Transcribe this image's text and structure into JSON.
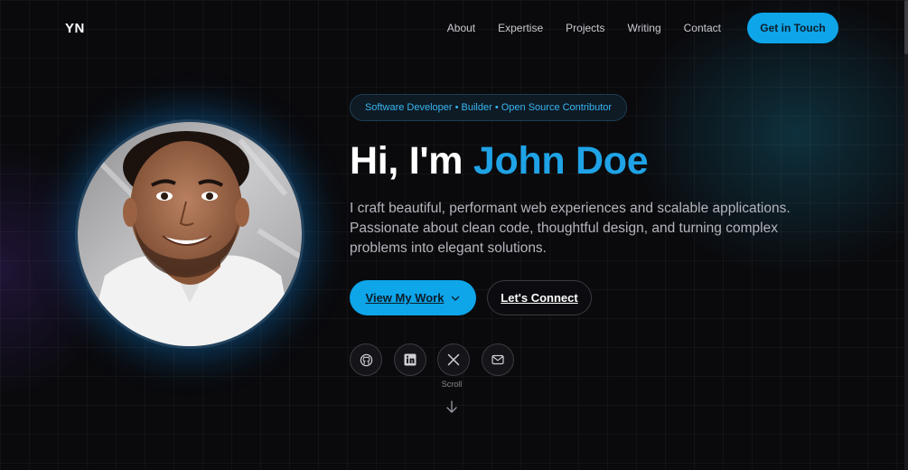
{
  "brand": {
    "logo": "YN"
  },
  "nav": {
    "items": [
      "About",
      "Expertise",
      "Projects",
      "Writing",
      "Contact"
    ],
    "cta": "Get in Touch"
  },
  "hero": {
    "badge": "Software Developer • Builder • Open Source Contributor",
    "greeting": "Hi, I'm",
    "name": "John Doe",
    "bio": "I craft beautiful, performant web experiences and scalable applications. Passionate about clean code, thoughtful design, and turning complex problems into elegant solutions.",
    "primary_button": "View My Work",
    "secondary_button": "Let's Connect",
    "social_icons": [
      "github-icon",
      "linkedin-icon",
      "x-icon",
      "mail-icon"
    ],
    "scroll_label": "Scroll"
  },
  "colors": {
    "accent": "#0ea5e9",
    "name_highlight": "#1fa3e6",
    "background": "#0a0a0d"
  }
}
